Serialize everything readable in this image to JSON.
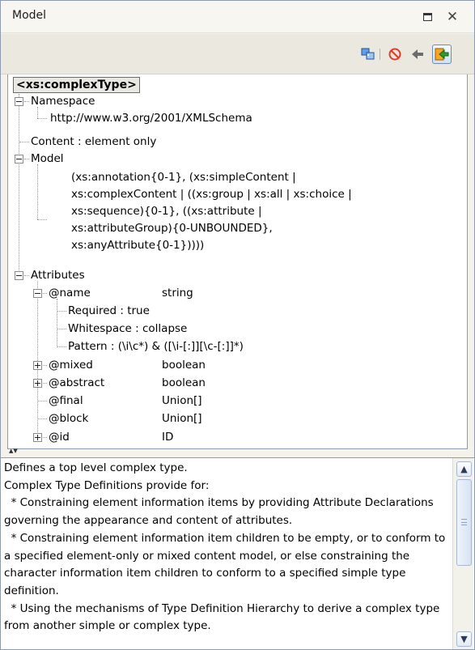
{
  "window": {
    "title": "Model"
  },
  "icons": {
    "minimize": "minimize-view-icon",
    "close": "close-icon",
    "sync": "sync-with-editor-icon",
    "stop": "stop-icon",
    "back": "back-arrow-icon",
    "next": "forward-icon"
  },
  "colors": {
    "accent": "#3f7fd8",
    "stop": "#e23b2a",
    "arrow": "#2c9e2c"
  },
  "tree": {
    "root": "<xs:complexType>",
    "namespace_label": "Namespace",
    "namespace_value": "http://www.w3.org/2001/XMLSchema",
    "content": "Content : element only",
    "model_label": "Model",
    "model_lines": [
      "(xs:annotation{0-1}, (xs:simpleContent |",
      "xs:complexContent | ((xs:group | xs:all | xs:choice |",
      "xs:sequence){0-1}, ((xs:attribute |",
      "xs:attributeGroup){0-UNBOUNDED},",
      "xs:anyAttribute{0-1}))))"
    ],
    "attributes_label": "Attributes",
    "attributes": [
      {
        "name": "@name",
        "type": "string"
      },
      {
        "name": "@mixed",
        "type": "boolean"
      },
      {
        "name": "@abstract",
        "type": "boolean"
      },
      {
        "name": "@final",
        "type": "Union[]"
      },
      {
        "name": "@block",
        "type": "Union[]"
      },
      {
        "name": "@id",
        "type": "ID"
      }
    ],
    "name_details": [
      "Required : true",
      "Whitespace : collapse",
      "Pattern : ([\\i-[:]][\\c-[:]]*)"
    ],
    "pattern_display": "Pattern : (\\i\\c*) & ([\\i-[:]][\\c-[:]]*)"
  },
  "description": {
    "text": "Defines a top level complex type.\nComplex Type Definitions provide for:\n  * Constraining element information items by providing Attribute Declarations governing the appearance and content of attributes.\n  * Constraining element information item children to be empty, or to conform to a specified element-only or mixed content model, or else constraining the character information item children to conform to a specified simple type definition.\n  * Using the mechanisms of Type Definition Hierarchy to derive a complex type from another simple or complex type."
  }
}
